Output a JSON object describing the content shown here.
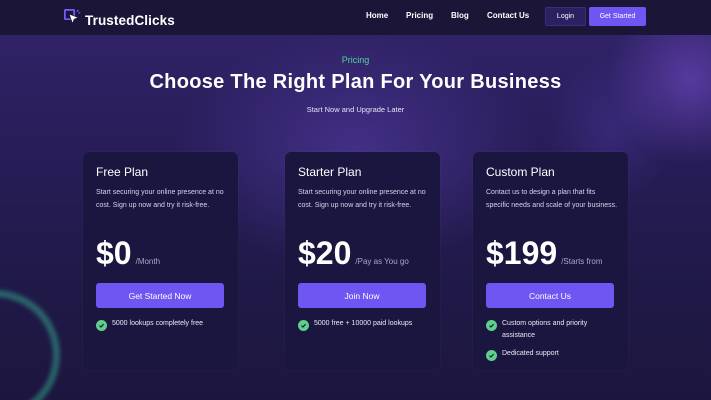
{
  "brand": {
    "name": "TrustedClicks"
  },
  "nav": {
    "links": [
      "Home",
      "Pricing",
      "Blog",
      "Contact Us"
    ],
    "login_label": "Login",
    "get_started_label": "Get Started"
  },
  "hero": {
    "eyebrow": "Pricing",
    "title": "Choose The Right Plan For Your Business",
    "subtitle": "Start Now and Upgrade Later"
  },
  "plans": [
    {
      "name": "Free Plan",
      "description": "Start securing your online presence at no cost. Sign up now and try it risk-free.",
      "price": "$0",
      "period": "/Month",
      "cta": "Get Started Now",
      "features": [
        "5000 lookups completely free"
      ]
    },
    {
      "name": "Starter Plan",
      "description": "Start securing your online presence at no cost. Sign up now and try it risk-free.",
      "price": "$20",
      "period": "/Pay as You go",
      "cta": "Join Now",
      "features": [
        "5000 free + 10000 paid lookups"
      ]
    },
    {
      "name": "Custom Plan",
      "description": "Contact us to design a plan that fits specific needs and scale of your business.",
      "price": "$199",
      "period": "/Starts from",
      "cta": "Contact Us",
      "features": [
        "Custom options and priority assistance",
        "Dedicated support"
      ]
    }
  ],
  "colors": {
    "accent": "#6f55f2",
    "eyebrow": "#52d39b",
    "check": "#5fcf8a",
    "card": "#1a1640"
  },
  "icons": {
    "logo": "cursor-click-logo-icon",
    "feature": "check-circle-icon"
  }
}
